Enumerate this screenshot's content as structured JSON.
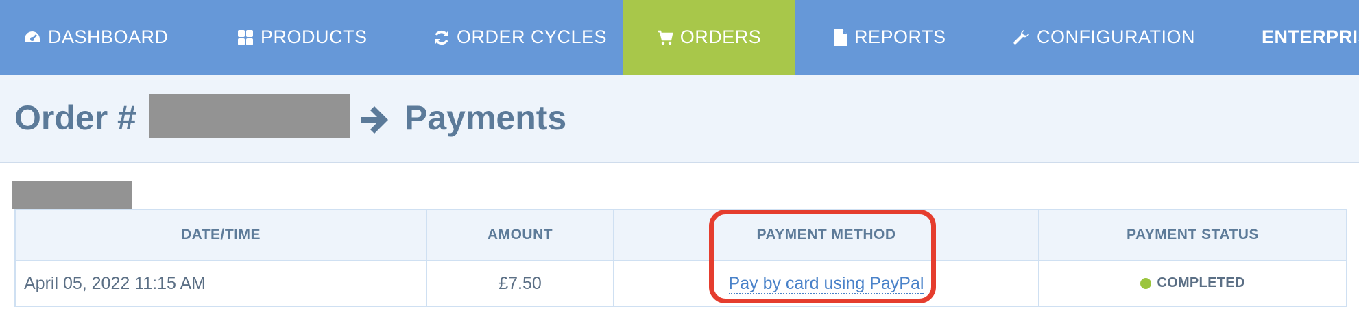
{
  "nav": {
    "items": [
      {
        "label": "DASHBOARD",
        "icon": "dashboard-icon"
      },
      {
        "label": "PRODUCTS",
        "icon": "grid-icon"
      },
      {
        "label": "ORDER CYCLES",
        "icon": "refresh-icon"
      },
      {
        "label": "ORDERS",
        "icon": "cart-icon",
        "active": true
      },
      {
        "label": "REPORTS",
        "icon": "document-icon"
      },
      {
        "label": "CONFIGURATION",
        "icon": "wrench-icon"
      },
      {
        "label": "ENTERPRISI"
      }
    ]
  },
  "page": {
    "title_prefix": "Order #",
    "title_suffix": "Payments"
  },
  "table": {
    "headers": [
      "DATE/TIME",
      "AMOUNT",
      "PAYMENT METHOD",
      "PAYMENT STATUS"
    ],
    "rows": [
      {
        "datetime": "April 05, 2022 11:15 AM",
        "amount": "£7.50",
        "method": "Pay by card using PayPal",
        "status": "COMPLETED"
      }
    ]
  },
  "colors": {
    "nav_bg": "#6698d8",
    "nav_active": "#a8c74a",
    "title": "#5b7a99",
    "highlight": "#e53d2e",
    "status_completed": "#9bc53d"
  }
}
